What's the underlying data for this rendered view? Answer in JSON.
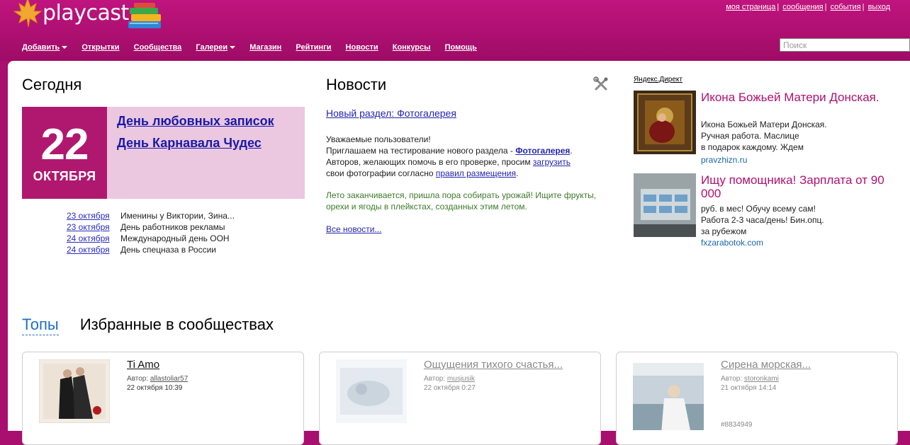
{
  "header": {
    "brand": "playcast",
    "top_links": [
      "моя страница",
      "сообщения",
      "события",
      "выход"
    ],
    "nav": [
      {
        "label": "Добавить",
        "dropdown": true
      },
      {
        "label": "Открытки",
        "dropdown": false
      },
      {
        "label": "Сообщества",
        "dropdown": false
      },
      {
        "label": "Галереи",
        "dropdown": true
      },
      {
        "label": "Магазин",
        "dropdown": false
      },
      {
        "label": "Рейтинги",
        "dropdown": false
      },
      {
        "label": "Новости",
        "dropdown": false
      },
      {
        "label": "Конкурсы",
        "dropdown": false
      },
      {
        "label": "Помощь",
        "dropdown": false
      }
    ],
    "search_placeholder": "Поиск"
  },
  "today": {
    "heading": "Сегодня",
    "day": "22",
    "month": "ОКТЯБРЯ",
    "events": [
      "День любовных записок",
      "День Карнавала Чудес"
    ],
    "upcoming": [
      {
        "date": "23 октября",
        "text": "Именины у Виктории, Зина..."
      },
      {
        "date": "23 октября",
        "text": "День работников рекламы"
      },
      {
        "date": "24 октября",
        "text": "Международный день ООН"
      },
      {
        "date": "24 октября",
        "text": "День спецназа в России"
      }
    ]
  },
  "news": {
    "heading": "Новости",
    "lead_link": "Новый раздел: Фотогалерея",
    "p1_a": "Уважаемые пользователи!",
    "p1_b": "Приглашаем на тестирование нового раздела - ",
    "p1_link": "Фотогалерея",
    "p1_c": "Авторов, желающих помочь в его проверке, просим ",
    "p1_link2": "загрузить",
    "p1_d": "свои фотографии согласно ",
    "p1_link3": "правил размещения",
    "p2": "Лето заканчивается, пришла пора собирать урожай! Ищите фрукты, орехи и ягоды в плейкстах, созданных этим летом.",
    "all_link": "Все новости..."
  },
  "ads": {
    "label": "Яндекс.Директ",
    "items": [
      {
        "title": "Икона Божьей Матери Донская.",
        "desc": [
          "Икона Божьей Матери Донская.",
          "Ручная работа. Маслице",
          "в подарок каждому. Ждем"
        ],
        "url": "pravzhizn.ru"
      },
      {
        "title": "Ищу помощника! Зарплата от 90 000",
        "desc": [
          "руб. в мес! Обучу всему сам!",
          "Работа 2-3 часа/день! Бин.опц.",
          "за рубежом"
        ],
        "url": "fxzarabotok.com"
      }
    ]
  },
  "tabs": {
    "active": "Топы",
    "other": "Избранные в сообществах"
  },
  "cards": [
    {
      "title": "Ti Amo",
      "author_label": "Автор:",
      "author": "allastoliar57",
      "date": "22 октября 10:39",
      "id": ""
    },
    {
      "title": "Ощущения тихого счастья...",
      "author_label": "Автор:",
      "author": "musjusik",
      "date": "22 октября 0:27",
      "id": ""
    },
    {
      "title": "Сирена морская...",
      "author_label": "Автор:",
      "author": "storonkami",
      "date": "21 октября 14:14",
      "id": "#8834949"
    }
  ],
  "colors": {
    "brand": "#b0186f",
    "accent_link": "#2424b0",
    "news_green": "#3d7a2a",
    "ad_title": "#b01070"
  }
}
